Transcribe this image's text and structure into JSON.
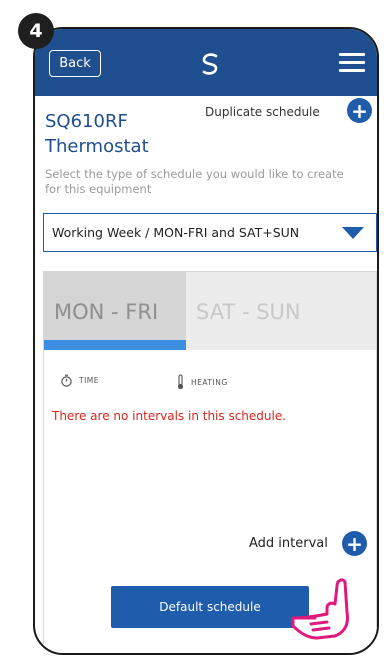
{
  "step": "4",
  "topbar": {
    "back_label": "Back",
    "logo_icon": "salus-logo-icon",
    "menu_icon": "hamburger-menu-icon",
    "color": "#1f4f8e"
  },
  "device": {
    "name_line1": "SQ610RF",
    "name_line2": "Thermostat"
  },
  "duplicate": {
    "label": "Duplicate schedule",
    "icon": "plus-icon"
  },
  "instruction": "Select the type of schedule you would like to create for this equipment",
  "schedule_type": {
    "selected": "Working Week / MON-FRI and SAT+SUN"
  },
  "tabs": [
    {
      "label": "MON - FRI",
      "active": true
    },
    {
      "label": "SAT - SUN",
      "active": false
    }
  ],
  "columns": {
    "time": "TIME",
    "heating": "HEATING"
  },
  "empty_message": "There are no intervals in this schedule.",
  "add_interval": {
    "label": "Add interval",
    "icon": "plus-icon"
  },
  "default_button": "Default schedule",
  "colors": {
    "accent": "#1f5cab",
    "tab_indicator": "#3c8fe0",
    "error": "#d9261c"
  }
}
